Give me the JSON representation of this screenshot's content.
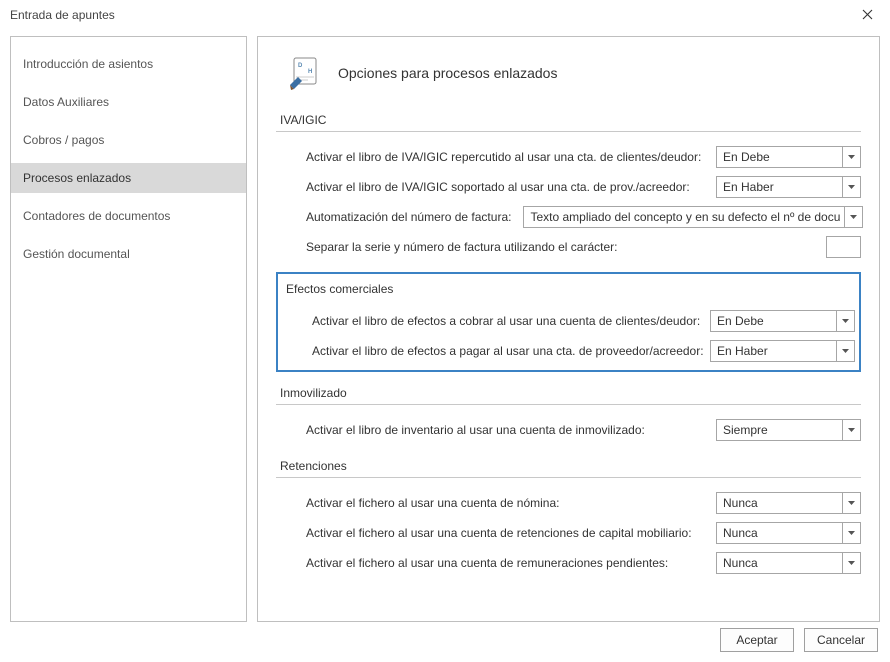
{
  "window": {
    "title": "Entrada de apuntes"
  },
  "sidebar": {
    "items": [
      {
        "label": "Introducción de asientos"
      },
      {
        "label": "Datos Auxiliares"
      },
      {
        "label": "Cobros / pagos"
      },
      {
        "label": "Procesos enlazados"
      },
      {
        "label": "Contadores de documentos"
      },
      {
        "label": "Gestión documental"
      }
    ],
    "selected_index": 3
  },
  "page": {
    "title": "Opciones para procesos enlazados",
    "sections": {
      "iva": {
        "title": "IVA/IGIC",
        "row1_label": "Activar el libro de IVA/IGIC repercutido al usar una cta. de clientes/deudor:",
        "row1_value": "En Debe",
        "row2_label": "Activar el libro de IVA/IGIC soportado al usar una cta. de prov./acreedor:",
        "row2_value": "En Haber",
        "row3_label": "Automatización del número de factura:",
        "row3_value": "Texto ampliado del concepto y en su defecto el nº de docu",
        "row4_label": "Separar la serie y número de factura utilizando el carácter:",
        "row4_value": ""
      },
      "efectos": {
        "title": "Efectos comerciales",
        "row1_label": "Activar el libro de efectos a cobrar al usar una cuenta de clientes/deudor:",
        "row1_value": "En Debe",
        "row2_label": "Activar el libro de efectos a pagar al usar una cta. de proveedor/acreedor:",
        "row2_value": "En Haber"
      },
      "inmov": {
        "title": "Inmovilizado",
        "row1_label": "Activar el libro de inventario al usar una cuenta de inmovilizado:",
        "row1_value": "Siempre"
      },
      "retenciones": {
        "title": "Retenciones",
        "row1_label": "Activar el fichero al usar una cuenta de nómina:",
        "row1_value": "Nunca",
        "row2_label": "Activar el fichero al usar una cuenta de retenciones de capital mobiliario:",
        "row2_value": "Nunca",
        "row3_label": "Activar el fichero al usar una cuenta de remuneraciones pendientes:",
        "row3_value": "Nunca"
      }
    }
  },
  "footer": {
    "accept_label": "Aceptar",
    "cancel_label": "Cancelar"
  }
}
